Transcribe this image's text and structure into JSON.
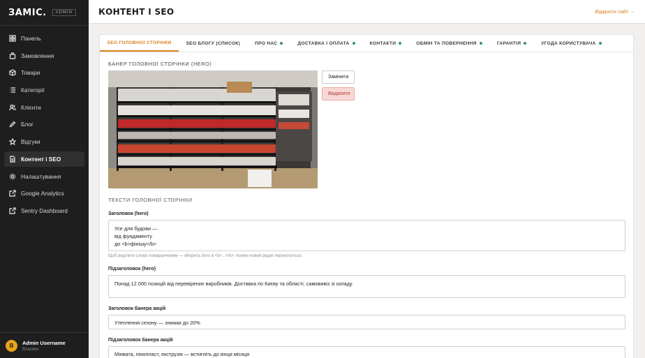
{
  "brand": {
    "name": "ЗАМІС.",
    "tag": "ADMIN"
  },
  "sidebar": {
    "items": [
      {
        "label": "Панель",
        "icon": "grid-icon"
      },
      {
        "label": "Замовлення",
        "icon": "bag-icon"
      },
      {
        "label": "Товари",
        "icon": "box-icon"
      },
      {
        "label": "Категорії",
        "icon": "list-icon"
      },
      {
        "label": "Клієнти",
        "icon": "users-icon"
      },
      {
        "label": "Блог",
        "icon": "pen-icon"
      },
      {
        "label": "Відгуки",
        "icon": "star-icon"
      },
      {
        "label": "Контент і SEO",
        "icon": "document-icon",
        "active": true
      },
      {
        "label": "Налаштування",
        "icon": "gear-icon"
      },
      {
        "label": "Google Analytics",
        "icon": "external-link-icon"
      },
      {
        "label": "Sentry Dashboard",
        "icon": "external-link-icon"
      }
    ]
  },
  "user": {
    "initial": "B",
    "name": "Admin Username",
    "role": "Власник"
  },
  "header": {
    "title": "КОНТЕНТ І SEO",
    "open_site": "Відкрити сайт →"
  },
  "tabs": [
    {
      "label": "SEO ГОЛОВНОЇ СТОРІНКИ",
      "active": true,
      "dot": false
    },
    {
      "label": "SEO БЛОГУ (СПИСОК)",
      "dot": false
    },
    {
      "label": "ПРО НАС",
      "dot": true
    },
    {
      "label": "ДОСТАВКА І ОПЛАТА",
      "dot": true
    },
    {
      "label": "КОНТАКТИ",
      "dot": true
    },
    {
      "label": "ОБМІН ТА ПОВЕРНЕННЯ",
      "dot": true
    },
    {
      "label": "ГАРАНТІЯ",
      "dot": true
    },
    {
      "label": "УГОДА КОРИСТУВАЧА",
      "dot": true
    }
  ],
  "banner": {
    "title": "БАНЕР ГОЛОВНОЇ СТОРІНКИ (HERO)",
    "replace_label": "Замінити",
    "delete_label": "Видалити"
  },
  "texts": {
    "title": "ТЕКСТИ ГОЛОВНОЇ СТОРІНКИ",
    "hero_title_label": "Заголовок (hero)",
    "hero_title_value": "Усе для будови —\nвід фундаменту\nдо <b>фінішу</b>",
    "hero_title_hint": "Щоб виділити слово помаранчевим — оберніть його в <b>...</b>. Кожен новий рядок переноситься.",
    "hero_subtitle_label": "Підзаголовок (hero)",
    "hero_subtitle_value": "Понад 12 000 позицій від перевірених виробників. Доставка по Києву та області, самовивіз зі складу.",
    "promo_title_label": "Заголовок банера акцій",
    "promo_title_value": "Утеплення сезону — знижки до 20%",
    "promo_subtitle_label": "Підзаголовок банера акцій",
    "promo_subtitle_value": "Мінвата, пінопласт, екструзія — встигніть до кінця місяця"
  },
  "colors": {
    "accent": "#d7821c",
    "sidebar_bg": "#1e1e1e",
    "status_dot": "#2e9c5a",
    "danger": "#b23a32"
  }
}
